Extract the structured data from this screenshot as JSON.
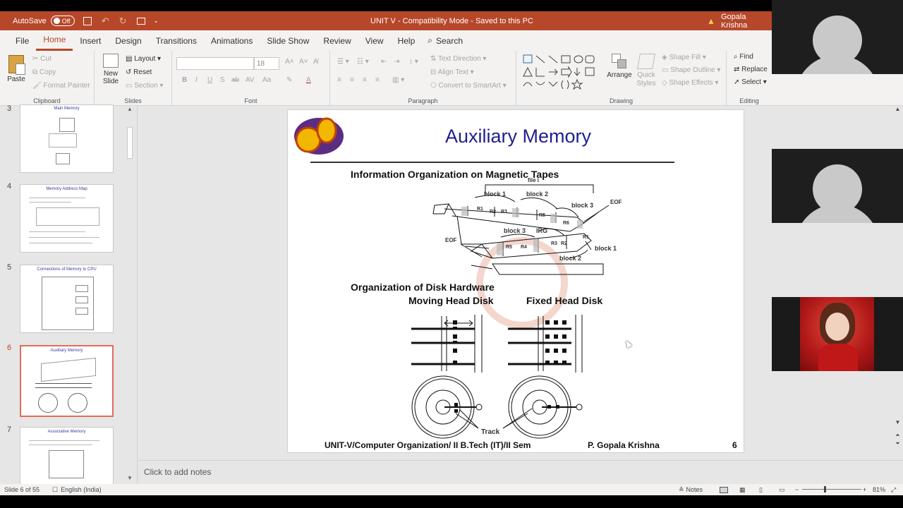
{
  "titlebar": {
    "autosave_label": "AutoSave",
    "autosave_state": "Off",
    "doc_title": "UNIT V  -  Compatibility Mode  -  Saved to this PC",
    "user_name": "Gopala Krishna"
  },
  "tabs": [
    "File",
    "Home",
    "Insert",
    "Design",
    "Transitions",
    "Animations",
    "Slide Show",
    "Review",
    "View",
    "Help"
  ],
  "search_label": "Search",
  "ribbon": {
    "clipboard": {
      "label": "Clipboard",
      "paste": "Paste",
      "cut": "Cut",
      "copy": "Copy",
      "format_painter": "Format Painter"
    },
    "slides": {
      "label": "Slides",
      "new_slide": "New",
      "new_slide2": "Slide",
      "layout": "Layout",
      "reset": "Reset",
      "section": "Section"
    },
    "font": {
      "label": "Font",
      "size": "18"
    },
    "paragraph": {
      "label": "Paragraph",
      "text_direction": "Text Direction",
      "align_text": "Align Text",
      "convert_smartart": "Convert to SmartArt"
    },
    "drawing": {
      "label": "Drawing",
      "arrange": "Arrange",
      "quick_styles": "Quick Styles",
      "shape_fill": "Shape Fill",
      "shape_outline": "Shape Outline",
      "shape_effects": "Shape Effects"
    },
    "editing": {
      "label": "Editing",
      "find": "Find",
      "replace": "Replace",
      "select": "Select"
    }
  },
  "thumbnails": [
    {
      "num": "3",
      "title": "Main Memory"
    },
    {
      "num": "4",
      "title": "Memory Address Map"
    },
    {
      "num": "5",
      "title": "Connections of Memory to CPU"
    },
    {
      "num": "6",
      "title": "Auxiliary Memory"
    },
    {
      "num": "7",
      "title": "Associative Memory"
    }
  ],
  "slide": {
    "title": "Auxiliary Memory",
    "tape_heading": "Information Organization on Magnetic Tapes",
    "file_label": "file i",
    "block1": "block 1",
    "block2": "block 2",
    "block3": "block 3",
    "eof": "EOF",
    "irg": "IRG",
    "r1": "R1",
    "r2": "R2",
    "r3": "R3",
    "r4": "R4",
    "r5": "R5",
    "r6": "R6",
    "disk_heading": "Organization of Disk Hardware",
    "moving_head": "Moving Head Disk",
    "fixed_head": "Fixed Head Disk",
    "track": "Track",
    "footer": "UNIT-V/Computer Organization/ II B.Tech (IT)/II Sem",
    "author": "P. Gopala Krishna",
    "page": "6"
  },
  "notes_placeholder": "Click to add notes",
  "status": {
    "slide_count": "Slide 6 of 55",
    "language": "English (India)",
    "notes": "Notes",
    "zoom": "81%"
  }
}
